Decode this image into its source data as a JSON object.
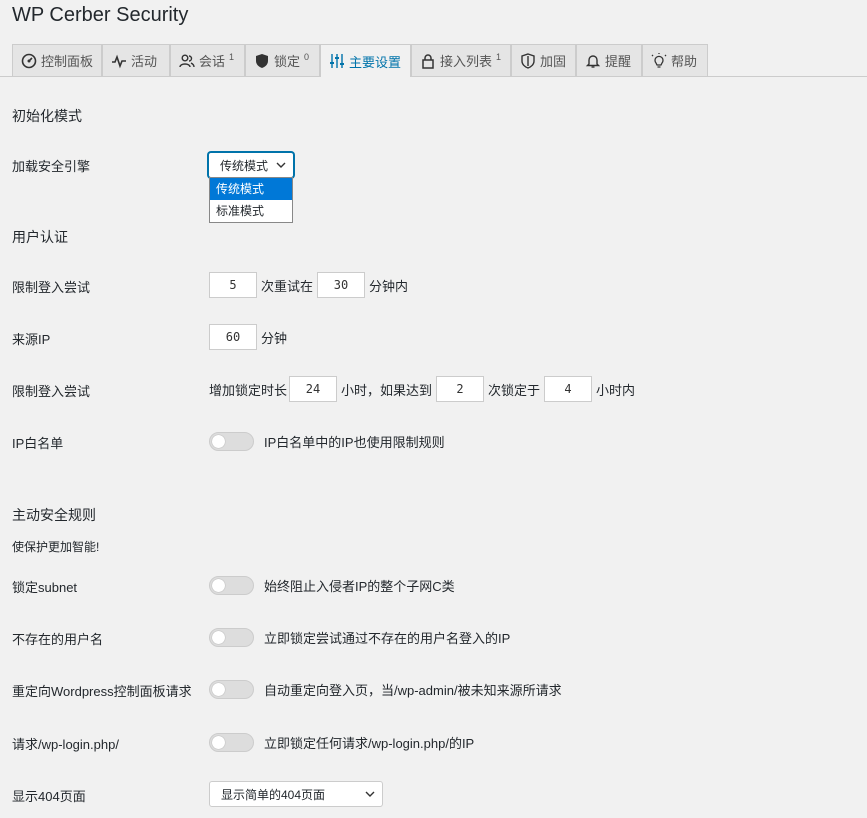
{
  "app": {
    "title": "WP Cerber Security"
  },
  "tabs": [
    {
      "label": "控制面板",
      "sup": ""
    },
    {
      "label": "活动",
      "sup": ""
    },
    {
      "label": "会话",
      "sup": "1"
    },
    {
      "label": "锁定",
      "sup": "0"
    },
    {
      "label": "主要设置",
      "sup": ""
    },
    {
      "label": "接入列表",
      "sup": "1"
    },
    {
      "label": "加固",
      "sup": ""
    },
    {
      "label": "提醒",
      "sup": ""
    },
    {
      "label": "帮助",
      "sup": ""
    }
  ],
  "active_tab": "主要设置",
  "accent_color": "#0073aa",
  "init": {
    "section_title": "初始化模式",
    "engine_label": "加载安全引擎",
    "engine_value": "传统模式",
    "engine_options": [
      "传统模式",
      "标准模式"
    ]
  },
  "auth": {
    "section_title": "用户认证",
    "limit_label": "限制登入尝试",
    "attempts": "5",
    "retry_text": "次重试在",
    "minutes": "30",
    "within_minutes": "分钟内",
    "source_ip_label": "来源IP",
    "source_ip_minutes": "60",
    "minutes_unit": "分钟",
    "limit2_label": "限制登入尝试",
    "increase_text": "增加锁定时长",
    "lock_hours": "24",
    "hours_if_text": "小时，如果达到",
    "lock_count": "2",
    "times_locked_text": "次锁定于",
    "within_hours": "4",
    "hours_within_text": "小时内",
    "whitelist_label": "IP白名单",
    "whitelist_text": "IP白名单中的IP也使用限制规则"
  },
  "proactive": {
    "section_title": "主动安全规则",
    "subtitle": "使保护更加智能!",
    "subnet_label": "锁定subnet",
    "subnet_text": "始终阻止入侵者IP的整个子网C类",
    "nonexist_label": "不存在的用户名",
    "nonexist_text": "立即锁定尝试通过不存在的用户名登入的IP",
    "redirect_label": "重定向Wordpress控制面板请求",
    "redirect_text": "自动重定向登入页，当/wp-admin/被未知来源所请求",
    "wplogin_label": "请求/wp-login.php/",
    "wplogin_text": "立即锁定任何请求/wp-login.php/的IP",
    "page404_label": "显示404页面",
    "page404_value": "显示简单的404页面"
  }
}
